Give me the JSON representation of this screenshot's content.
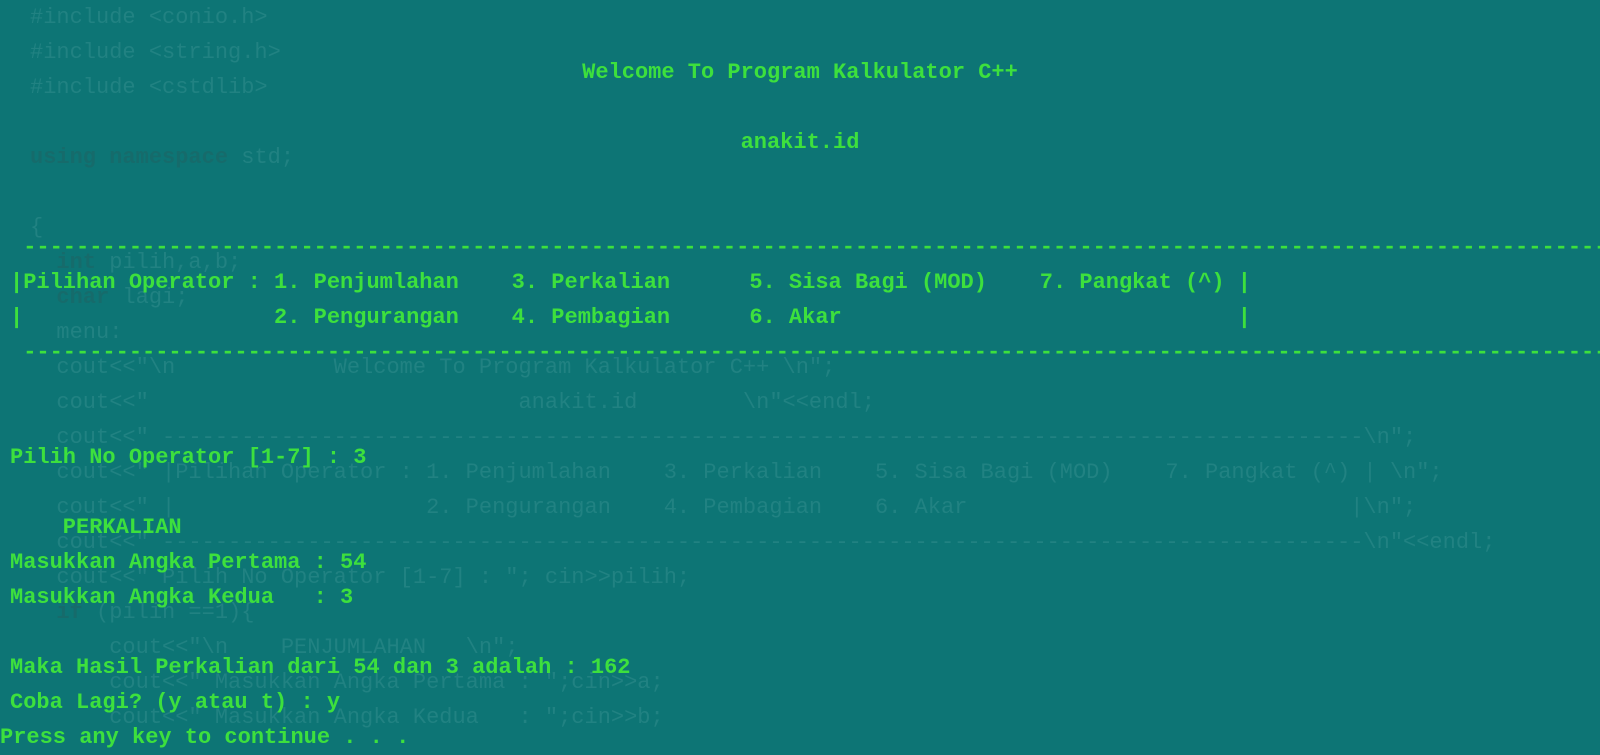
{
  "title_line1": "Welcome To Program Kalkulator C++",
  "title_line2": "anakit.id",
  "dash_line": " ---------------------------------------------------------------------------------------------------------------------------",
  "operator_row1": "|Pilihan Operator : 1. Penjumlahan    3. Perkalian      5. Sisa Bagi (MOD)    7. Pangkat (^) |",
  "operator_row2": "|                   2. Pengurangan    4. Pembagian      6. Akar                              |",
  "prompt_pick": "Pilih No Operator [1-7] : 3",
  "operation_name": "    PERKALIAN",
  "input_first": "Masukkan Angka Pertama : 54",
  "input_second": "Masukkan Angka Kedua   : 3",
  "result_line": "Maka Hasil Perkalian dari 54 dan 3 adalah : 162",
  "retry_prompt": "Coba Lagi? (y atau t) : y",
  "press_any": "Press any key to continue . . .",
  "bg": {
    "l1": "#include <conio.h>",
    "l2": "#include <string.h>",
    "l3": "#include <cstdlib>",
    "l5a": "using",
    "l5b": " namespace",
    "l5c": " std;",
    "l7": "{",
    "l8a": "  int",
    "l8b": " pilih,a,b;",
    "l9a": "  char",
    "l9b": " lagi;",
    "l10": "  menu:",
    "l11": "  cout<<\"\\n            Welcome To Program Kalkulator C++ \\n\";",
    "l12": "  cout<<\"                            anakit.id        \\n\"<<endl;",
    "l13": "  cout<<\" -------------------------------------------------------------------------------------------\\n\";",
    "l14": "  cout<<\" |Pilihan Operator : 1. Penjumlahan    3. Perkalian    5. Sisa Bagi (MOD)    7. Pangkat (^) | \\n\";",
    "l15": "  cout<<\" |                   2. Pengurangan    4. Pembagian    6. Akar                             |\\n\";",
    "l16": "  cout<<\" -------------------------------------------------------------------------------------------\\n\"<<endl;",
    "l17": "  cout<<\" Pilih No Operator [1-7] : \"; cin>>pilih;",
    "l18a": "  if",
    "l18b": " (pilih ==1){",
    "l19": "      cout<<\"\\n    PENJUMLAHAN   \\n\";",
    "l20": "      cout<<\" Masukkan Angka Pertama : \";cin>>a;",
    "l21": "      cout<<\" Masukkan Angka Kedua   : \";cin>>b;"
  }
}
